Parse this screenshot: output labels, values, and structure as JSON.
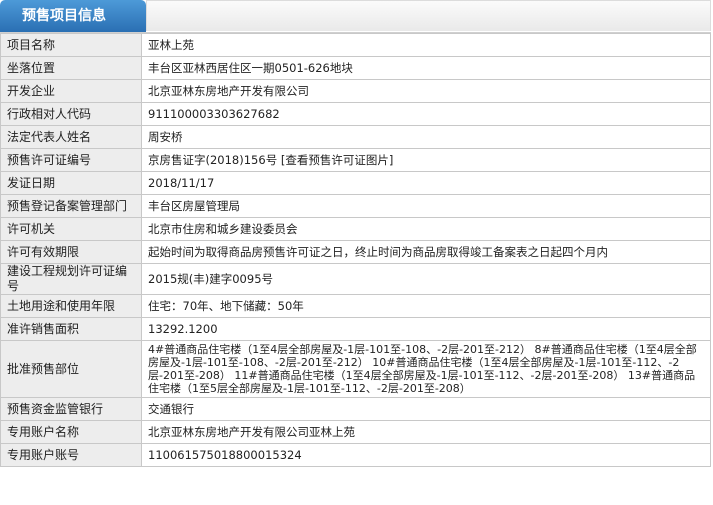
{
  "header": {
    "tab_title": "预售项目信息"
  },
  "rows": [
    {
      "label": "项目名称",
      "value": "亚林上苑"
    },
    {
      "label": "坐落位置",
      "value": "丰台区亚林西居住区一期0501-626地块"
    },
    {
      "label": "开发企业",
      "value": "北京亚林东房地产开发有限公司"
    },
    {
      "label": "行政相对人代码",
      "value": "911100003303627682"
    },
    {
      "label": "法定代表人姓名",
      "value": "周安桥"
    },
    {
      "label": "预售许可证编号",
      "value": "京房售证字(2018)156号",
      "link": "[查看预售许可证图片]"
    },
    {
      "label": "发证日期",
      "value": "2018/11/17"
    },
    {
      "label": "预售登记备案管理部门",
      "value": "丰台区房屋管理局"
    },
    {
      "label": "许可机关",
      "value": "北京市住房和城乡建设委员会"
    },
    {
      "label": "许可有效期限",
      "value": "起始时间为取得商品房预售许可证之日，终止时间为商品房取得竣工备案表之日起四个月内"
    },
    {
      "label": "建设工程规划许可证编号",
      "value": "2015规(丰)建字0095号"
    },
    {
      "label": "土地用途和使用年限",
      "value": "住宅：70年、地下储藏：50年"
    },
    {
      "label": "准许销售面积",
      "value": "13292.1200"
    },
    {
      "label": "批准预售部位",
      "value": "4#普通商品住宅楼（1至4层全部房屋及-1层-101至-108、-2层-201至-212） 8#普通商品住宅楼（1至4层全部房屋及-1层-101至-108、-2层-201至-212） 10#普通商品住宅楼（1至4层全部房屋及-1层-101至-112、-2层-201至-208） 11#普通商品住宅楼（1至4层全部房屋及-1层-101至-112、-2层-201至-208） 13#普通商品住宅楼（1至5层全部房屋及-1层-101至-112、-2层-201至-208）"
    },
    {
      "label": "预售资金监管银行",
      "value": "交通银行"
    },
    {
      "label": "专用账户名称",
      "value": "北京亚林东房地产开发有限公司亚林上苑"
    },
    {
      "label": "专用账户账号",
      "value": "110061575018800015324"
    }
  ]
}
